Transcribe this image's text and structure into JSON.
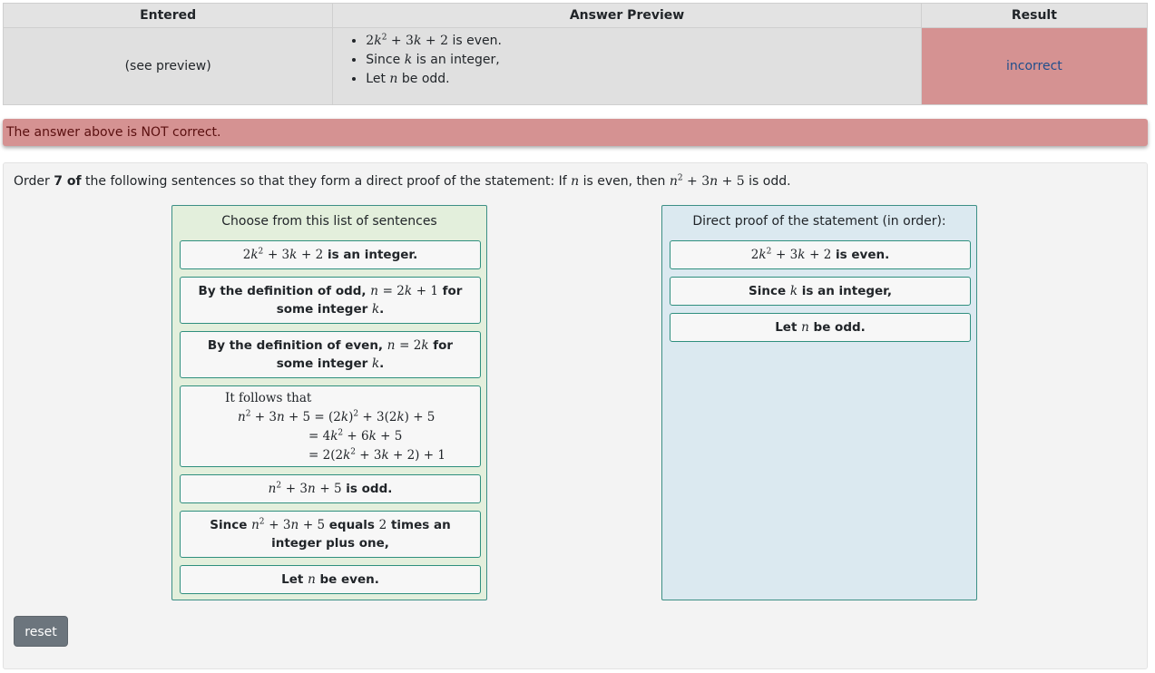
{
  "results_table": {
    "headers": [
      "Entered",
      "Answer Preview",
      "Result"
    ],
    "entered": "(see preview)",
    "preview_items": [
      {
        "math": "2k² + 3k + 2",
        "text": " is even."
      },
      {
        "text_before": "Since ",
        "math": "k",
        "text": " is an integer,"
      },
      {
        "text_before": "Let ",
        "math": "n",
        "text": " be odd."
      }
    ],
    "result": "incorrect"
  },
  "alert": "The answer above is NOT correct.",
  "problem": {
    "prompt_start": "Order ",
    "prompt_count": "7 of",
    "prompt_mid": " the following sentences so that they form a direct proof of the statement: If ",
    "prompt_n": "n",
    "prompt_mid2": " is even, then ",
    "prompt_expr": "n² + 3n + 5",
    "prompt_end": " is odd."
  },
  "source_list": {
    "title": "Choose from this list of sentences",
    "items": [
      "2k² + 3k + 2 is an integer.",
      "By the definition of odd, n = 2k + 1 for some integer k.",
      "By the definition of even, n = 2k for some integer k.",
      "It follows that n² + 3n + 5 = (2k)² + 3(2k) + 5 = 4k² + 6k + 5 = 2(2k² + 3k + 2) + 1",
      "n² + 3n + 5 is odd.",
      "Since n² + 3n + 5 equals 2 times an integer plus one,",
      "Let n be even."
    ]
  },
  "target_list": {
    "title": "Direct proof of the statement (in order):",
    "items": [
      "2k² + 3k + 2 is even.",
      "Since k is an integer,",
      "Let n be odd."
    ]
  },
  "reset_label": "reset",
  "colors": {
    "incorrect_bg": "#d59292",
    "source_bg": "#e3efdc",
    "target_bg": "#dbe9f0",
    "item_border": "#2f8f7e",
    "reset_bg": "#6c757d"
  }
}
